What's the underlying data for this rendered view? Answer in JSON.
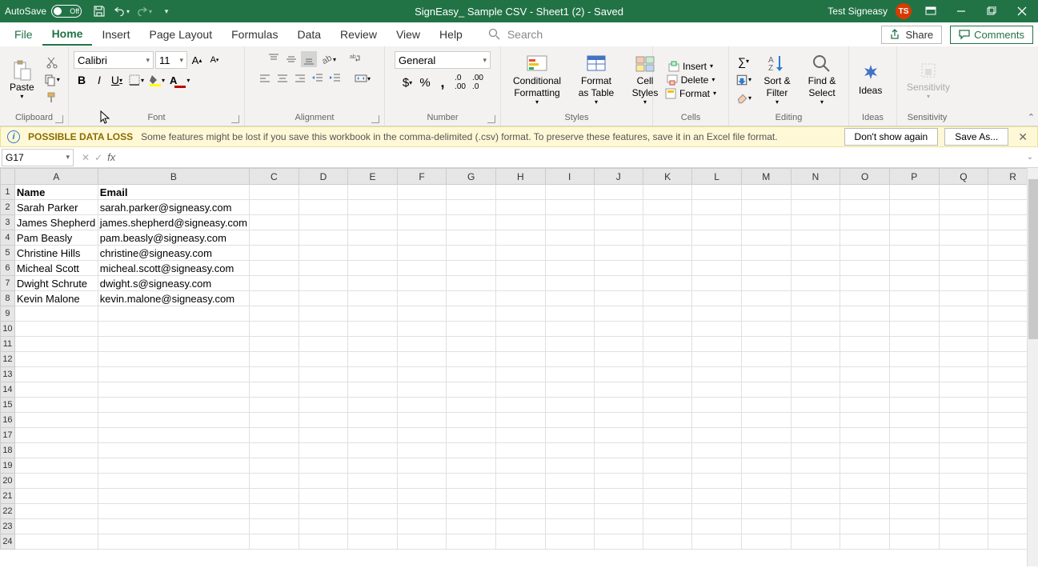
{
  "titlebar": {
    "autosave_label": "AutoSave",
    "autosave_state": "Off",
    "doc_title": "SignEasy_ Sample CSV - Sheet1 (2)  -  Saved",
    "user_name": "Test Signeasy",
    "user_initials": "TS"
  },
  "tabs": {
    "file": "File",
    "home": "Home",
    "insert": "Insert",
    "page_layout": "Page Layout",
    "formulas": "Formulas",
    "data": "Data",
    "review": "Review",
    "view": "View",
    "help": "Help",
    "search_placeholder": "Search",
    "share": "Share",
    "comments": "Comments"
  },
  "ribbon": {
    "clipboard": {
      "paste": "Paste",
      "label": "Clipboard"
    },
    "font": {
      "name": "Calibri",
      "size": "11",
      "label": "Font"
    },
    "alignment": {
      "label": "Alignment"
    },
    "number": {
      "format": "General",
      "label": "Number"
    },
    "styles": {
      "cond": "Conditional Formatting",
      "table": "Format as Table",
      "cell": "Cell Styles",
      "label": "Styles"
    },
    "cells": {
      "insert": "Insert",
      "delete": "Delete",
      "format": "Format",
      "label": "Cells"
    },
    "editing": {
      "sort": "Sort & Filter",
      "find": "Find & Select",
      "label": "Editing"
    },
    "ideas": {
      "ideas": "Ideas",
      "label": "Ideas"
    },
    "sensitivity": {
      "sens": "Sensitivity",
      "label": "Sensitivity"
    }
  },
  "msgbar": {
    "title": "POSSIBLE DATA LOSS",
    "text": "Some features might be lost if you save this workbook in the comma-delimited (.csv) format. To preserve these features, save it in an Excel file format.",
    "dont_show": "Don't show again",
    "save_as": "Save As..."
  },
  "fxbar": {
    "namebox": "G17"
  },
  "columns": [
    "A",
    "B",
    "C",
    "D",
    "E",
    "F",
    "G",
    "H",
    "I",
    "J",
    "K",
    "L",
    "M",
    "N",
    "O",
    "P",
    "Q",
    "R"
  ],
  "sheet": {
    "headers": {
      "A": "Name",
      "B": "Email"
    },
    "rows": [
      {
        "A": "Sarah Parker",
        "B": "sarah.parker@signeasy.com"
      },
      {
        "A": "James Shepherd",
        "B": "james.shepherd@signeasy.com"
      },
      {
        "A": "Pam Beasly",
        "B": "pam.beasly@signeasy.com"
      },
      {
        "A": "Christine Hills",
        "B": "christine@signeasy.com"
      },
      {
        "A": "Micheal Scott",
        "B": "micheal.scott@signeasy.com"
      },
      {
        "A": "Dwight Schrute",
        "B": "dwight.s@signeasy.com"
      },
      {
        "A": "Kevin Malone",
        "B": "kevin.malone@signeasy.com"
      }
    ]
  }
}
